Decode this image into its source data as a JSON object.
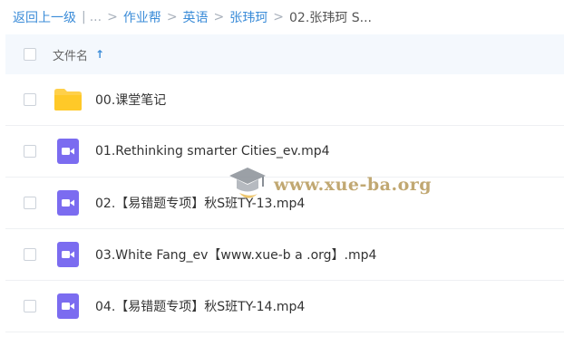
{
  "breadcrumb": {
    "back": "返回上一级",
    "ellipsis": "...",
    "items": [
      "作业帮",
      "英语",
      "张玮珂"
    ],
    "current": "02.张玮珂 S..."
  },
  "header": {
    "column_name": "文件名",
    "sort_indicator": "↑"
  },
  "files": [
    {
      "name": "00.课堂笔记",
      "type": "folder"
    },
    {
      "name": "01.Rethinking smarter Cities_ev.mp4",
      "type": "video"
    },
    {
      "name": "02.【易错题专项】秋S班TY-13.mp4",
      "type": "video"
    },
    {
      "name": "03.White Fang_ev【www.xue-b a .org】.mp4",
      "type": "video"
    },
    {
      "name": "04.【易错题专项】秋S班TY-14.mp4",
      "type": "video"
    }
  ],
  "watermark": {
    "text": "www.xue-ba.org"
  },
  "colors": {
    "link": "#3b8cd8",
    "folder": "#ffd04a",
    "video": "#7b6cf0",
    "header_bg": "#f4f8fd"
  },
  "icons": {
    "folder": "folder-icon",
    "video": "video-file-icon",
    "watermark": "graduation-cap-icon"
  }
}
